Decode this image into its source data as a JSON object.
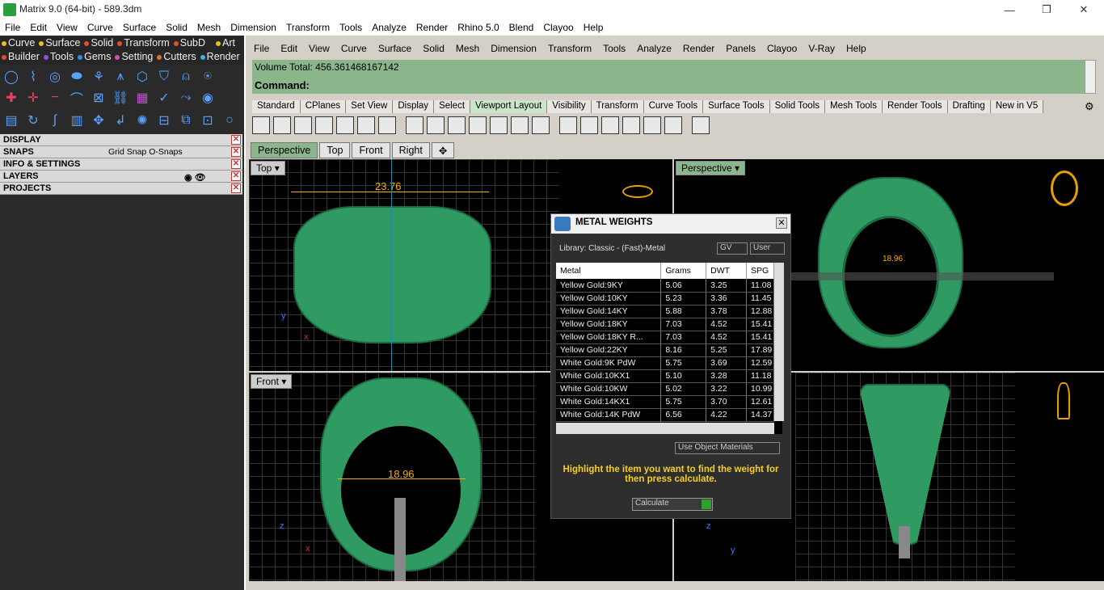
{
  "window": {
    "title": "Matrix 9.0 (64-bit) - 589.3dm",
    "minimize": "—",
    "maximize": "❐",
    "close": "✕"
  },
  "menu1": [
    "File",
    "Edit",
    "View",
    "Curve",
    "Surface",
    "Solid",
    "Mesh",
    "Dimension",
    "Transform",
    "Tools",
    "Analyze",
    "Render",
    "Rhino 5.0",
    "Blend",
    "Clayoo",
    "Help"
  ],
  "plugins_row1": [
    {
      "label": "Curve",
      "color": "#e8c020"
    },
    {
      "label": "Surface",
      "color": "#e8c020"
    },
    {
      "label": "Solid",
      "color": "#e05030"
    },
    {
      "label": "Transform",
      "color": "#e05030"
    },
    {
      "label": "SubD",
      "color": "#e05030"
    },
    {
      "label": "Art",
      "color": "#e8c020"
    }
  ],
  "plugins_row2": [
    {
      "label": "Builder",
      "color": "#e05030"
    },
    {
      "label": "Tools",
      "color": "#9050d0"
    },
    {
      "label": "Gems",
      "color": "#3090e0"
    },
    {
      "label": "Setting",
      "color": "#d050c0"
    },
    {
      "label": "Cutters",
      "color": "#e07030"
    },
    {
      "label": "Render",
      "color": "#40b0e0"
    }
  ],
  "panels": [
    {
      "label": "DISPLAY",
      "extra": ""
    },
    {
      "label": "SNAPS",
      "extra": "Grid Snap   O-Snaps"
    },
    {
      "label": "INFO & SETTINGS",
      "extra": ""
    },
    {
      "label": "LAYERS",
      "extra": ""
    },
    {
      "label": "PROJECTS",
      "extra": ""
    }
  ],
  "menu2": [
    "File",
    "Edit",
    "View",
    "Curve",
    "Surface",
    "Solid",
    "Mesh",
    "Dimension",
    "Transform",
    "Tools",
    "Analyze",
    "Render",
    "Panels",
    "Clayoo",
    "V-Ray",
    "Help"
  ],
  "command": {
    "volume_text": "Volume Total: 456.361468167142",
    "prompt": "Command:"
  },
  "toolbar_tabs": [
    "Standard",
    "CPlanes",
    "Set View",
    "Display",
    "Select",
    "Viewport Layout",
    "Visibility",
    "Transform",
    "Curve Tools",
    "Surface Tools",
    "Solid Tools",
    "Mesh Tools",
    "Render Tools",
    "Drafting",
    "New in V5"
  ],
  "active_toolbar_tab": "Viewport Layout",
  "viewport_tabs": [
    "Perspective",
    "Top",
    "Front",
    "Right",
    "✥"
  ],
  "viewports": {
    "top": {
      "label": "Top",
      "dim": "23.76",
      "axis_y": "y",
      "axis_x": "x"
    },
    "perspective": {
      "label": "Perspective",
      "dim": "18.96"
    },
    "front": {
      "label": "Front",
      "dim": "18.96",
      "axis_z": "z",
      "axis_x": "x"
    },
    "right": {
      "axis_z": "z",
      "axis_y": "y"
    }
  },
  "metal_weights": {
    "title": "METAL WEIGHTS",
    "library": "Library: Classic - (Fast)-Metal",
    "gv": "GV",
    "user": "User",
    "columns": [
      "Metal",
      "Grams",
      "DWT",
      "SPG"
    ],
    "rows": [
      [
        "Yellow Gold:9KY",
        "5.06",
        "3.25",
        "11.08"
      ],
      [
        "Yellow Gold:10KY",
        "5.23",
        "3.36",
        "11.45"
      ],
      [
        "Yellow Gold:14KY",
        "5.88",
        "3.78",
        "12.88"
      ],
      [
        "Yellow Gold:18KY",
        "7.03",
        "4.52",
        "15.41"
      ],
      [
        "Yellow Gold:18KY R...",
        "7.03",
        "4.52",
        "15.41"
      ],
      [
        "Yellow Gold:22KY",
        "8.16",
        "5.25",
        "17.89"
      ],
      [
        "White Gold:9K PdW",
        "5.75",
        "3.69",
        "12.59"
      ],
      [
        "White Gold:10KX1",
        "5.10",
        "3.28",
        "11.18"
      ],
      [
        "White Gold:10KW",
        "5.02",
        "3.22",
        "10.99"
      ],
      [
        "White Gold:14KX1",
        "5.75",
        "3.70",
        "12.61"
      ],
      [
        "White Gold:14K PdW",
        "6.56",
        "4.22",
        "14.37"
      ]
    ],
    "use_object_materials": "Use Object Materials",
    "message": "Highlight the item you want to find the weight for then press calculate.",
    "calculate": "Calculate"
  }
}
